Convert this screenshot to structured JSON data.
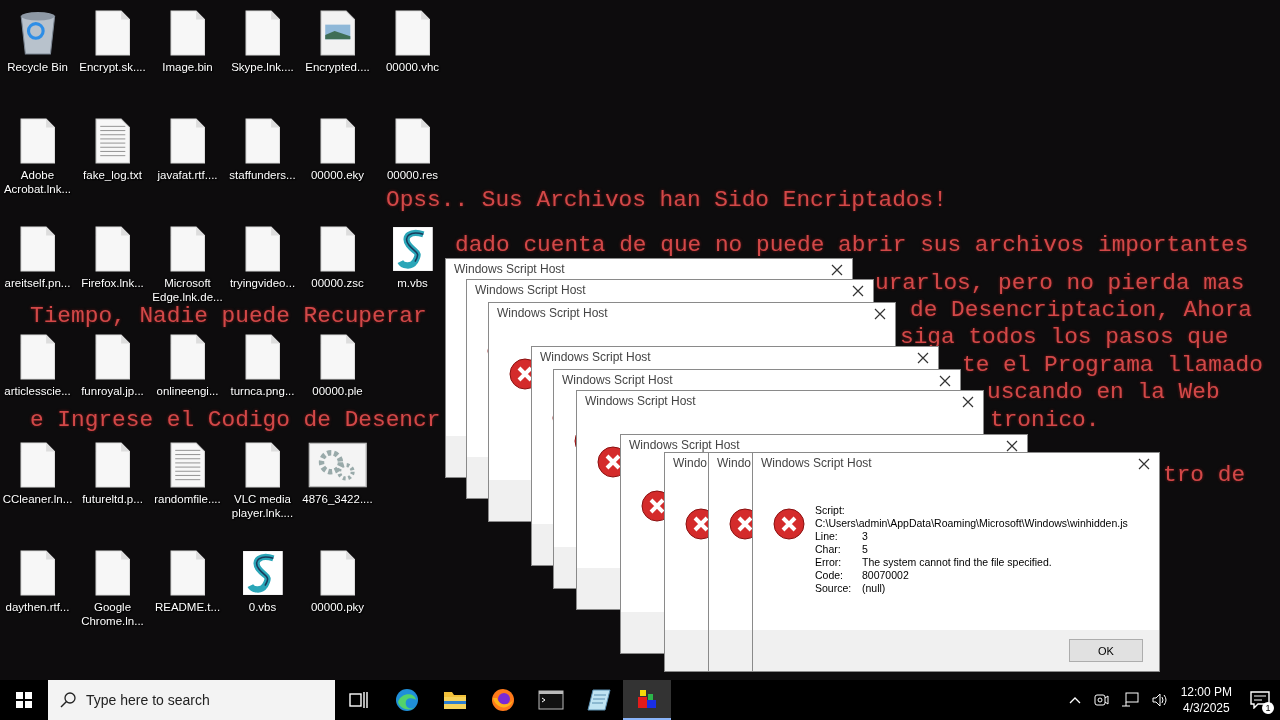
{
  "desktop": {
    "rows": [
      [
        {
          "label": "Recycle Bin",
          "kind": "recycle"
        },
        {
          "label": "Encrypt.sk....",
          "kind": "file"
        },
        {
          "label": "Image.bin",
          "kind": "file"
        },
        {
          "label": "Skype.lnk....",
          "kind": "file"
        },
        {
          "label": "Encrypted....",
          "kind": "image"
        },
        {
          "label": "00000.vhc",
          "kind": "file"
        }
      ],
      [
        {
          "label": "Adobe Acrobat.lnk...",
          "kind": "file"
        },
        {
          "label": "fake_log.txt",
          "kind": "text"
        },
        {
          "label": "javafat.rtf....",
          "kind": "file"
        },
        {
          "label": "staffunders...",
          "kind": "file"
        },
        {
          "label": "00000.eky",
          "kind": "file"
        },
        {
          "label": "00000.res",
          "kind": "file"
        }
      ],
      [
        {
          "label": "areitself.pn...",
          "kind": "file"
        },
        {
          "label": "Firefox.lnk...",
          "kind": "file"
        },
        {
          "label": "Microsoft Edge.lnk.de...",
          "kind": "file"
        },
        {
          "label": "tryingvideo...",
          "kind": "file"
        },
        {
          "label": "00000.zsc",
          "kind": "file"
        },
        {
          "label": "m.vbs",
          "kind": "script"
        }
      ],
      [
        {
          "label": "articlesscie...",
          "kind": "file"
        },
        {
          "label": "funroyal.jp...",
          "kind": "file"
        },
        {
          "label": "onlineengi...",
          "kind": "file"
        },
        {
          "label": "turnca.png...",
          "kind": "file"
        },
        {
          "label": "00000.ple",
          "kind": "file"
        }
      ],
      [
        {
          "label": "CCleaner.ln...",
          "kind": "file"
        },
        {
          "label": "futureltd.p...",
          "kind": "file"
        },
        {
          "label": "randomfile....",
          "kind": "text"
        },
        {
          "label": "VLC media player.lnk....",
          "kind": "file"
        },
        {
          "label": "4876_3422....",
          "kind": "gear"
        }
      ],
      [
        {
          "label": "daythen.rtf...",
          "kind": "file"
        },
        {
          "label": "Google Chrome.ln...",
          "kind": "file"
        },
        {
          "label": "README.t...",
          "kind": "file"
        },
        {
          "label": "0.vbs",
          "kind": "script"
        },
        {
          "label": "00000.pky",
          "kind": "file"
        }
      ]
    ]
  },
  "wallpaper_text": [
    "Opss.. Sus Archivos han Sido Encriptados!",
    "dado cuenta de que no puede abrir sus archivos importantes",
    "urarlos, pero no pierda mas",
    "Tiempo, Nadie puede Recuperar",
    "de Desencriptacion, Ahora",
    "siga todos los pasos que",
    "te el Programa llamado",
    "uscando en la Web",
    "e Ingrese el Codigo de Desencr",
    "tronico.",
    "tro de"
  ],
  "dialogs": [
    {
      "title": "Windows Script Host"
    },
    {
      "title": "Windows Script Host"
    },
    {
      "title": "Windows Script Host"
    },
    {
      "title": "Windows Script Host"
    },
    {
      "title": "Windows Script Host"
    },
    {
      "title": "Windows Script Host"
    },
    {
      "title": "Windows Script Host"
    },
    {
      "title": "Windo"
    },
    {
      "title": "Windo"
    },
    {
      "title": "Windows Script Host",
      "script_label": "Script:",
      "script_path": "C:\\Users\\admin\\AppData\\Roaming\\Microsoft\\Windows\\winhidden.js",
      "details": [
        {
          "label": "Line:",
          "value": "3"
        },
        {
          "label": "Char:",
          "value": "5"
        },
        {
          "label": "Error:",
          "value": "The system cannot find the file specified."
        },
        {
          "label": "Code:",
          "value": "80070002"
        },
        {
          "label": "Source:",
          "value": "(null)"
        }
      ],
      "button": "OK"
    }
  ],
  "taskbar": {
    "search": {
      "placeholder": "Type here to search"
    },
    "apps": [
      {
        "kind": "taskview",
        "selected": false
      },
      {
        "kind": "edge",
        "selected": false
      },
      {
        "kind": "explorer",
        "selected": false
      },
      {
        "kind": "firefox",
        "selected": false
      },
      {
        "kind": "terminal",
        "selected": false
      },
      {
        "kind": "notepad",
        "selected": false
      },
      {
        "kind": "blocks",
        "selected": true
      }
    ],
    "time": "12:00 PM",
    "date": "4/3/2025",
    "notification_count": "1"
  }
}
